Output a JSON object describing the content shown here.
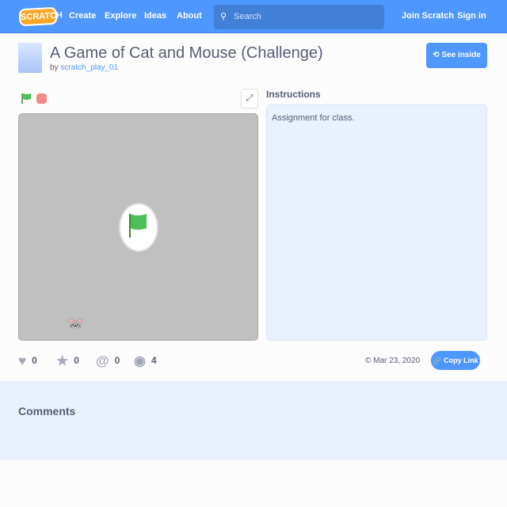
{
  "nav": {
    "logo": "SCRATCH",
    "items": [
      "Create",
      "Explore",
      "Ideas",
      "About"
    ],
    "search_placeholder": "Search",
    "join": "Join Scratch",
    "signin": "Sign in"
  },
  "project": {
    "title": "A Game of Cat and Mouse (Challenge)",
    "by": "by",
    "author": "scratch_play_01",
    "see_inside": "See inside"
  },
  "instructions": {
    "heading": "Instructions",
    "text": "Assignment for class."
  },
  "stats": {
    "loves": "0",
    "favorites": "0",
    "remixes": "0",
    "views": "4"
  },
  "date": "© Mar 23, 2020",
  "copy_link": "Copy Link",
  "comments": {
    "heading": "Comments"
  }
}
